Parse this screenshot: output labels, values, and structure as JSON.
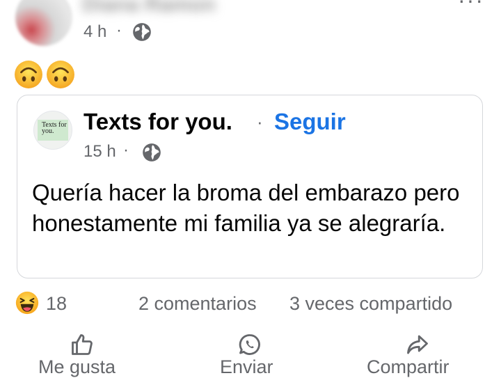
{
  "post": {
    "author_name": "Diana Ramon",
    "time": "4 h",
    "separator": "·",
    "privacy_icon": "globe-icon",
    "more_icon": "more-options-icon",
    "more_label": "···",
    "text_emojis": [
      "upside-down-face-emoji",
      "upside-down-face-emoji"
    ]
  },
  "shared_post": {
    "page_name": "Texts for you.",
    "separator": "·",
    "follow_label": "Seguir",
    "time": "15 h",
    "privacy_icon": "globe-icon",
    "logo_text": "Texts for you.",
    "text": "Quería hacer la broma del embarazo pero honestamente mi familia ya se alegraría."
  },
  "stats": {
    "reaction_icon": "haha-reaction-icon",
    "reaction_count": "18",
    "comments": "2 comentarios",
    "shares": "3 veces compartido"
  },
  "actions": [
    {
      "label": "Me gusta",
      "icon": "thumbs-up-icon"
    },
    {
      "label": "Enviar",
      "icon": "whatsapp-icon"
    },
    {
      "label": "Compartir",
      "icon": "share-arrow-icon"
    }
  ],
  "colors": {
    "link_blue": "#1b74e4",
    "secondary_text": "#65676b",
    "primary_text": "#050505",
    "card_border": "#d5d7db"
  }
}
